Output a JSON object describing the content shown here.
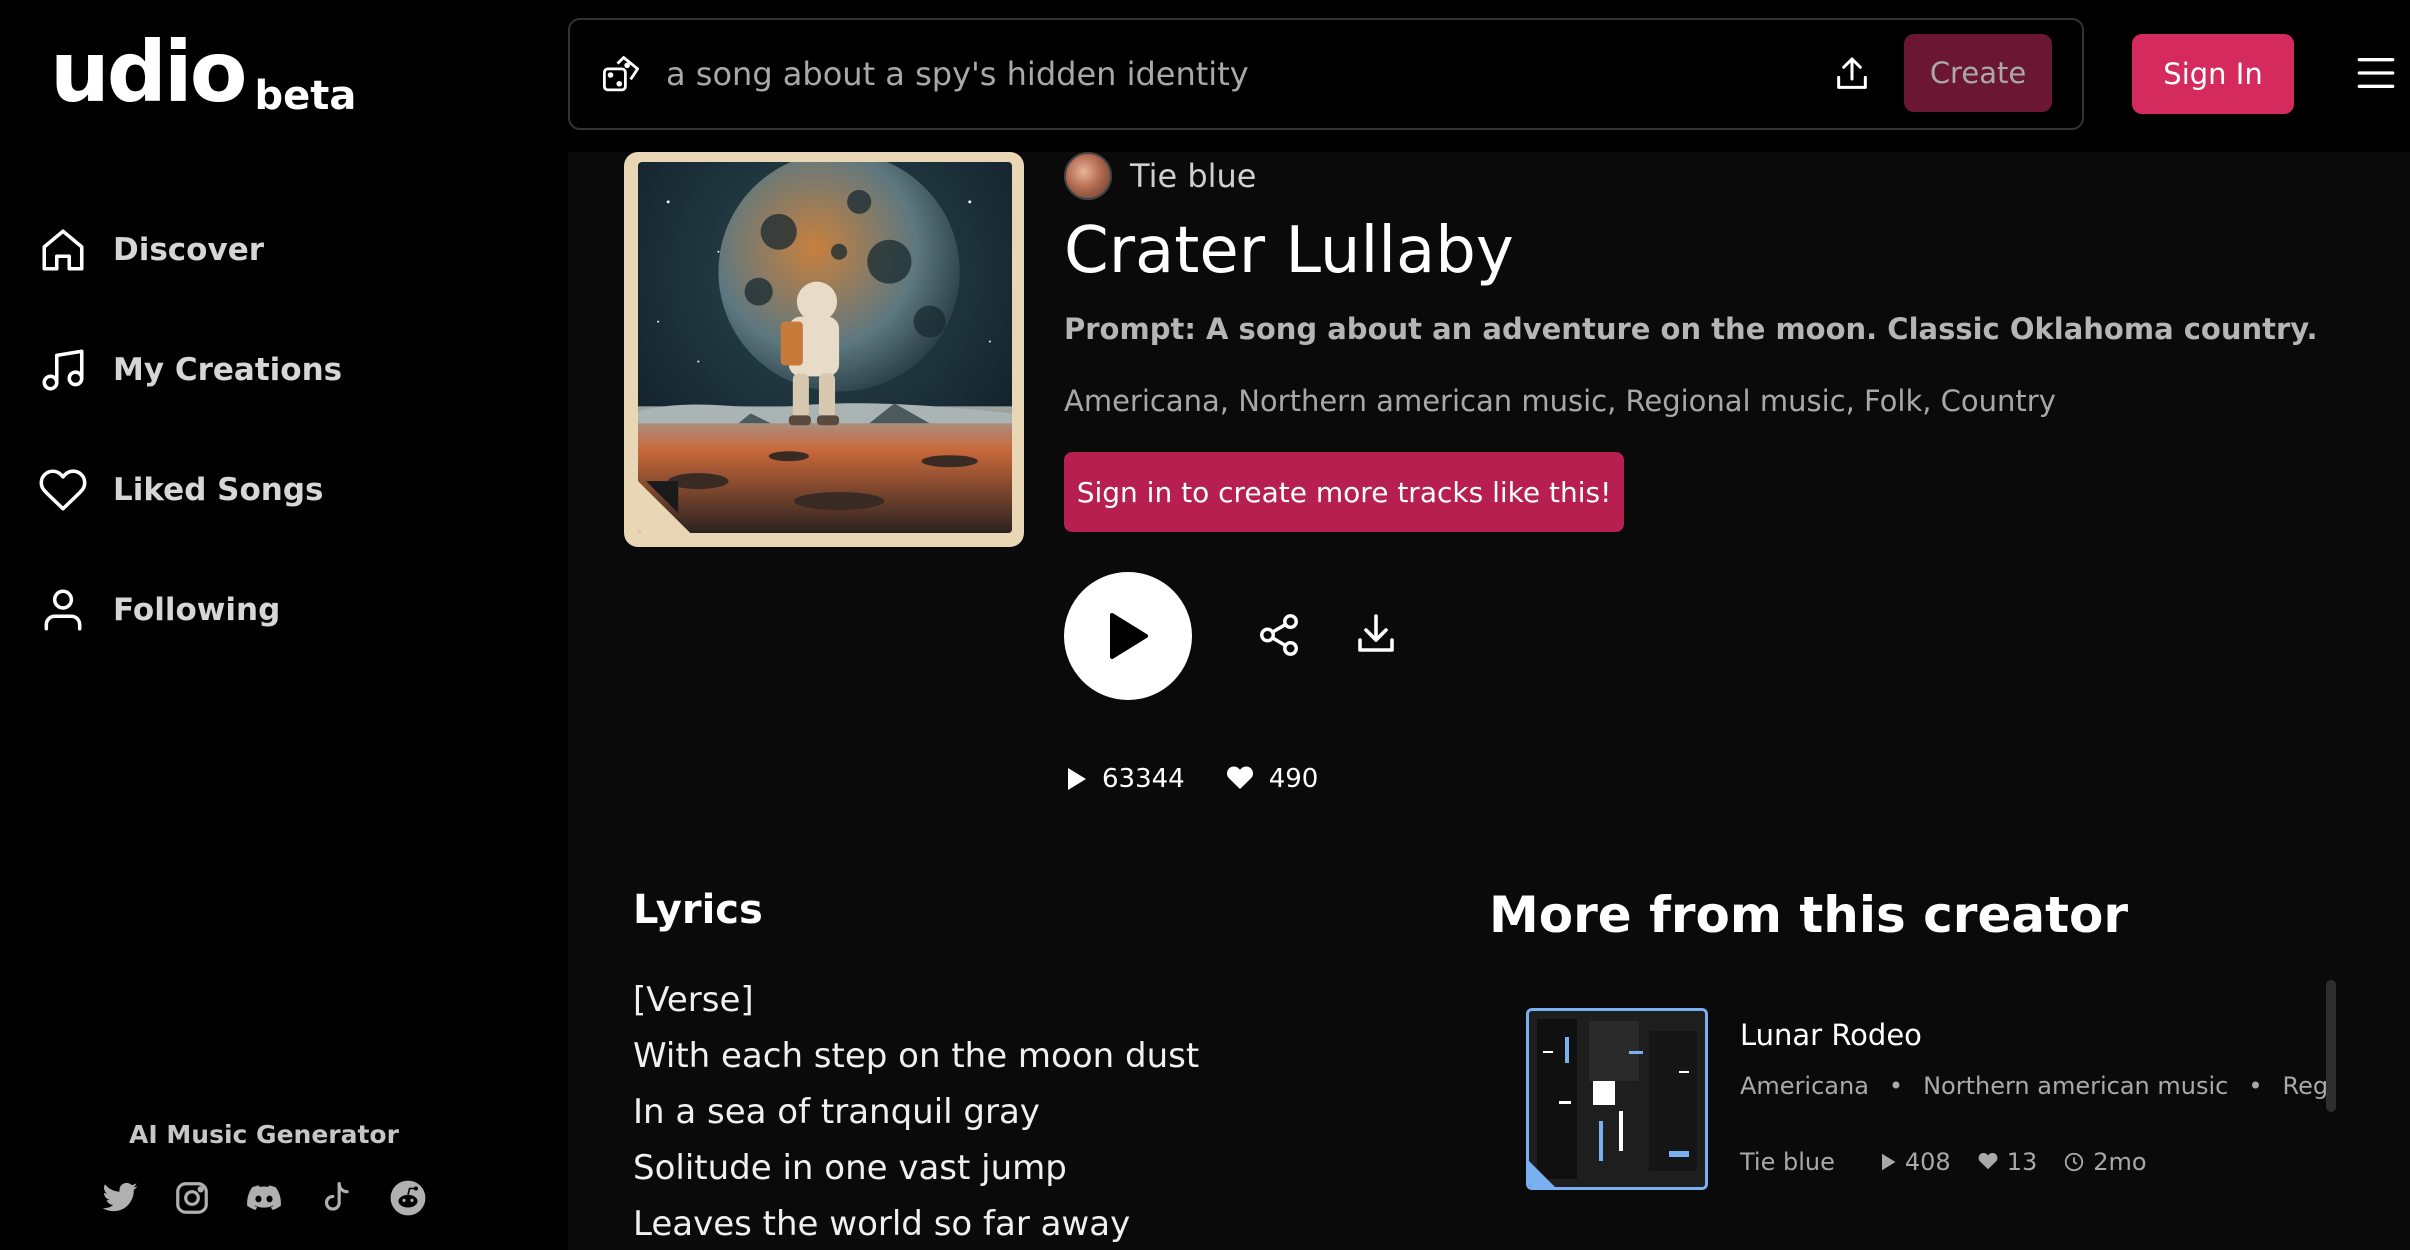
{
  "brand": {
    "name": "udio",
    "badge": "beta"
  },
  "sidebar": {
    "items": [
      {
        "label": "Discover",
        "icon": "home-icon"
      },
      {
        "label": "My Creations",
        "icon": "music-note-icon"
      },
      {
        "label": "Liked Songs",
        "icon": "heart-icon"
      },
      {
        "label": "Following",
        "icon": "user-icon"
      }
    ],
    "footer_label": "AI Music Generator",
    "socials": [
      "twitter-icon",
      "instagram-icon",
      "discord-icon",
      "tiktok-icon",
      "reddit-icon"
    ]
  },
  "header": {
    "prompt_placeholder": "a song about a spy's hidden identity",
    "create_label": "Create",
    "signin_label": "Sign In"
  },
  "song": {
    "creator": "Tie blue",
    "title": "Crater Lullaby",
    "prompt": "Prompt: A song about an adventure on the moon. Classic Oklahoma country.",
    "tags": "Americana, Northern american music, Regional music, Folk, Country",
    "cta_label": "Sign in to create more tracks like this!",
    "plays": "63344",
    "likes": "490"
  },
  "lyrics": {
    "heading": "Lyrics",
    "lines": [
      "[Verse]",
      "With each step on the moon dust",
      "In a sea of tranquil gray",
      "Solitude in one vast jump",
      "Leaves the world so far away"
    ]
  },
  "more_from_creator": {
    "heading": "More from this creator",
    "tracks": [
      {
        "title": "Lunar Rodeo",
        "tags": [
          "Americana",
          "Northern american music",
          "Regiona"
        ],
        "creator": "Tie blue",
        "plays": "408",
        "likes": "13",
        "age": "2mo"
      }
    ]
  },
  "colors": {
    "accent": "#d42a5e",
    "accent_dark": "#b61f50",
    "create_bg": "#6b1632",
    "background": "#000000",
    "main_bg": "#0a0a0b",
    "thumb_border": "#7ab0f0"
  }
}
